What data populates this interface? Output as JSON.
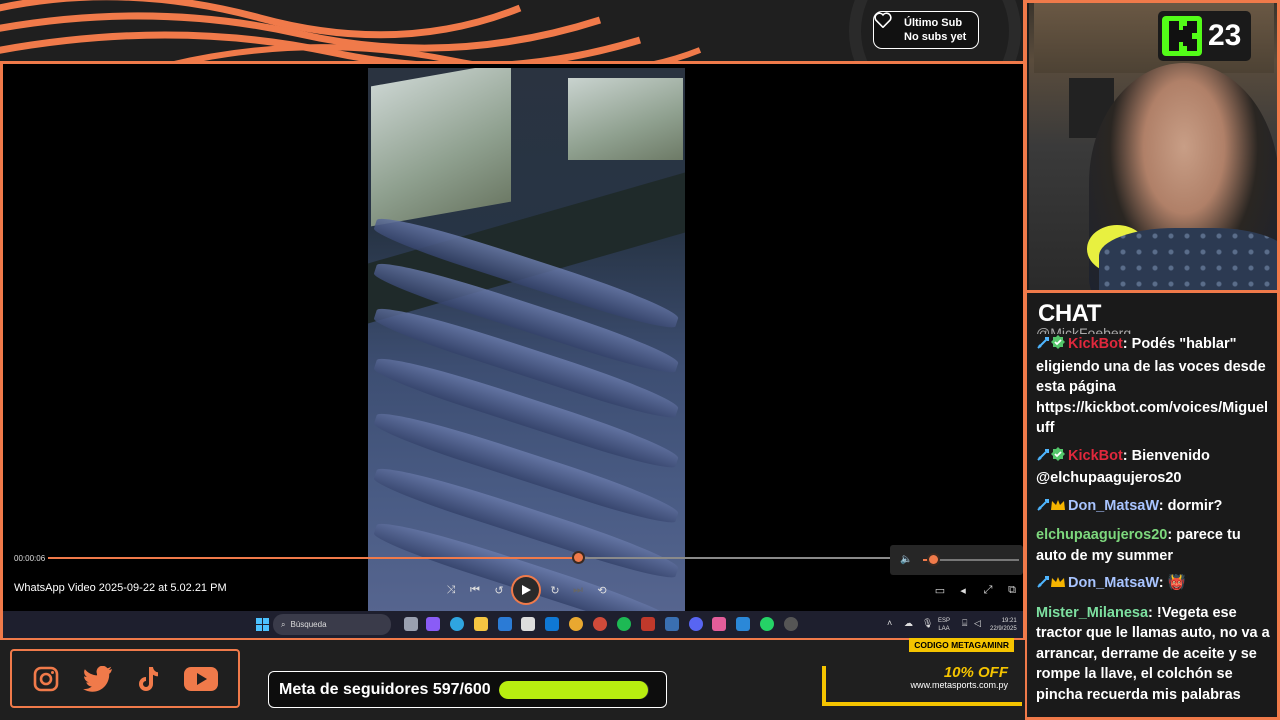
{
  "overlay": {
    "last_sub_title": "Último Sub",
    "last_sub_value": "No subs yet",
    "follower_goal": "Meta de seguidores 597/600",
    "follower_goal_progress": 0.995,
    "kick_viewer_count": "23",
    "promo_code_label": "CODIGO METAGAMINR",
    "promo_discount": "10% OFF",
    "promo_url": "www.metasports.com.py",
    "social_icons": [
      "instagram-icon",
      "twitter-icon",
      "tiktok-icon",
      "youtube-icon"
    ],
    "accent_color": "#f07a4a",
    "kick_green": "#53fc18",
    "goal_bar_color": "#b8ee10"
  },
  "player": {
    "current_time": "00:00:06",
    "seek_progress": 0.63,
    "volume_level": 0.1,
    "video_title": "WhatsApp Video 2025-09-22 at 5.02.21 PM"
  },
  "taskbar": {
    "search_placeholder": "Búsqueda",
    "lang_top": "ESP",
    "lang_bottom": "LAA",
    "clock_time": "19:21",
    "clock_date": "22/9/2025"
  },
  "chat": {
    "title": "CHAT",
    "partial_top": "@MickFoeberg",
    "messages": [
      {
        "user": "KickBot",
        "user_color": "#e0283c",
        "badges": true,
        "crown": false,
        "text": "Podés \"hablar\" eligiendo una de las voces desde esta página https://kickbot.com/voices/Migueluff"
      },
      {
        "user": "KickBot",
        "user_color": "#e0283c",
        "badges": true,
        "crown": false,
        "text": "Bienvenido @elchupaagujeros20"
      },
      {
        "user": "Don_MatsaW",
        "user_color": "#a8c4ff",
        "badges": true,
        "crown": true,
        "text": "dormir?"
      },
      {
        "user": "elchupaagujeros20",
        "user_color": "#7dd87d",
        "badges": false,
        "crown": false,
        "text": "parece tu auto de my summer"
      },
      {
        "user": "Don_MatsaW",
        "user_color": "#a8c4ff",
        "badges": true,
        "crown": true,
        "text": "👹"
      },
      {
        "user": "Mister_Milanesa",
        "user_color": "#7de0a0",
        "badges": false,
        "crown": false,
        "text": "!Vegeta ese tractor que le llamas auto, no va a arrancar, derrame de aceite y se rompe la llave, el colchón se pincha recuerda mis palabras"
      }
    ]
  }
}
